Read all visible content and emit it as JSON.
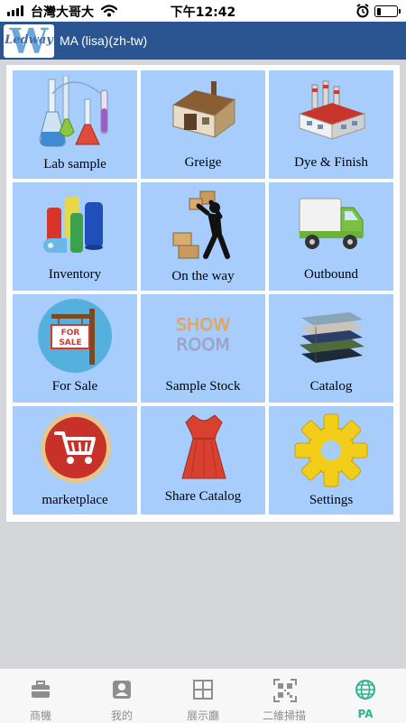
{
  "status_bar": {
    "carrier": "台灣大哥大",
    "time": "下午12:42",
    "battery_level": 0.2
  },
  "header": {
    "logo_text": "Ledway",
    "title": "MA (lisa)(zh-tw)"
  },
  "tiles": [
    {
      "label": "Lab sample",
      "icon": "lab-flasks-icon"
    },
    {
      "label": "Greige",
      "icon": "warehouse-icon"
    },
    {
      "label": "Dye & Finish",
      "icon": "factory-icon"
    },
    {
      "label": "Inventory",
      "icon": "fabric-rolls-icon"
    },
    {
      "label": "On the way",
      "icon": "porter-carrying-boxes-icon"
    },
    {
      "label": "Outbound",
      "icon": "truck-icon"
    },
    {
      "label": "For Sale",
      "icon": "for-sale-sign-icon"
    },
    {
      "label": "Sample Stock",
      "icon": "showroom-icon",
      "icon_text": [
        "SHOW",
        "ROOM"
      ]
    },
    {
      "label": "Catalog",
      "icon": "fabric-stack-icon"
    },
    {
      "label": "marketplace",
      "icon": "shopping-cart-icon"
    },
    {
      "label": "Share Catalog",
      "icon": "dress-icon"
    },
    {
      "label": "Settings",
      "icon": "gear-icon"
    }
  ],
  "tabbar": [
    {
      "label": "商機",
      "icon": "briefcase-icon"
    },
    {
      "label": "我的",
      "icon": "profile-icon"
    },
    {
      "label": "展示廳",
      "icon": "grid-icon"
    },
    {
      "label": "二維掃描",
      "icon": "qr-code-icon"
    },
    {
      "label": "PA",
      "icon": "globe-icon",
      "active": true
    }
  ],
  "colors": {
    "header": "#2a5591",
    "tile": "#a7cdfd",
    "background": "#d4d6da",
    "active_tab": "#2db38f"
  }
}
